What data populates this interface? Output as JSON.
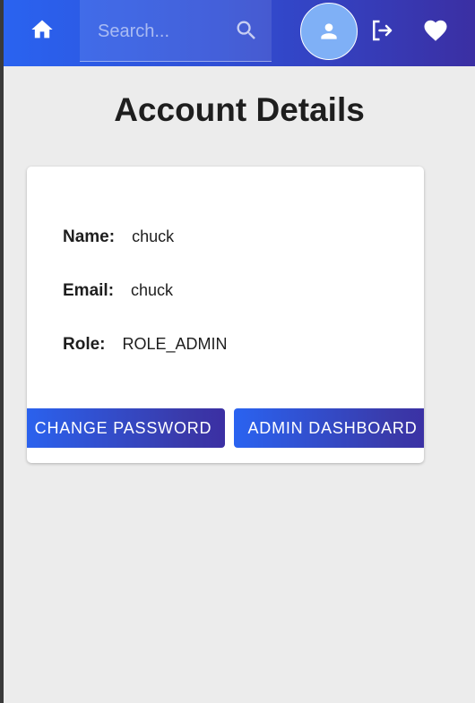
{
  "header": {
    "search_placeholder": "Search...",
    "icons": [
      "home-icon",
      "search-icon",
      "person-icon",
      "logout-icon",
      "heart-icon"
    ]
  },
  "main": {
    "title": "Account Details",
    "fields": [
      {
        "label": "Name:",
        "value": "chuck"
      },
      {
        "label": "Email:",
        "value": "chuck"
      },
      {
        "label": "Role:",
        "value": "ROLE_ADMIN"
      }
    ],
    "buttons": {
      "change_password": "CHANGE PASSWORD",
      "admin_dashboard": "ADMIN DASHBOARD"
    }
  },
  "colors": {
    "appbar_start": "#2a63f0",
    "appbar_end": "#3b2fa3",
    "avatar_bg": "#7fb0f6",
    "page_bg": "#ececec"
  }
}
